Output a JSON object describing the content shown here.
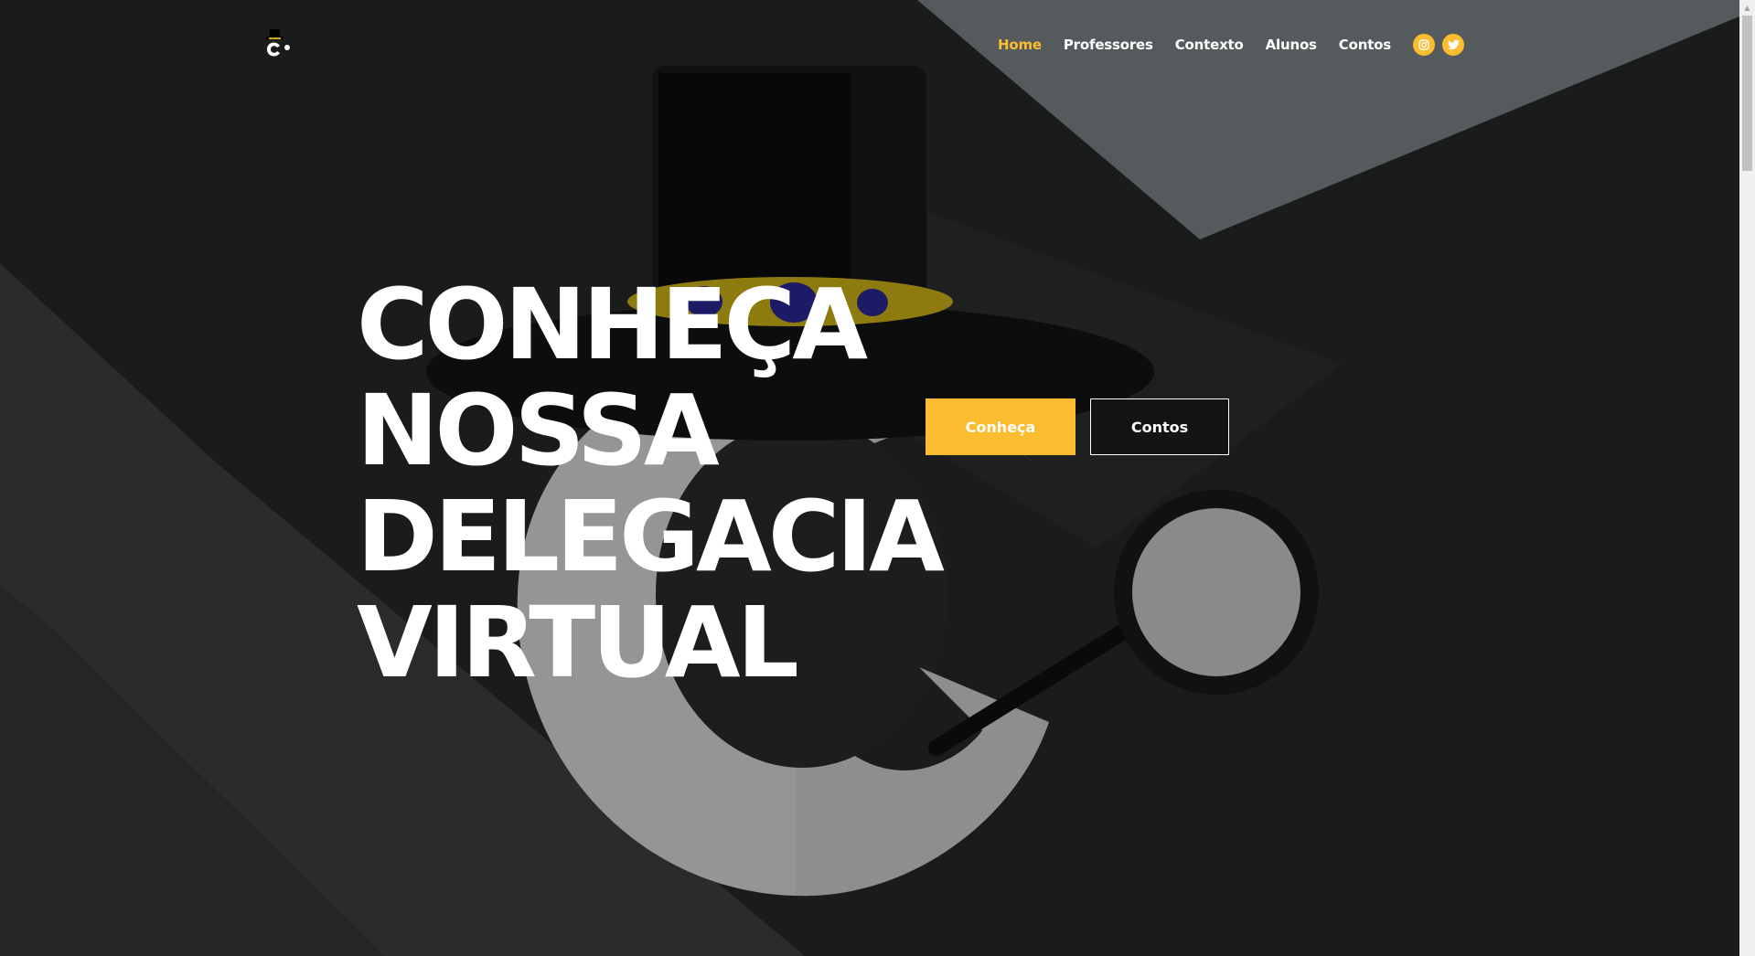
{
  "site": {
    "logo_icon": "detective-c-logo"
  },
  "nav": {
    "items": [
      {
        "label": "Home",
        "active": true
      },
      {
        "label": "Professores",
        "active": false
      },
      {
        "label": "Contexto",
        "active": false
      },
      {
        "label": "Alunos",
        "active": false
      },
      {
        "label": "Contos",
        "active": false
      }
    ],
    "social": [
      {
        "icon": "instagram-icon"
      },
      {
        "icon": "twitter-icon"
      }
    ]
  },
  "hero": {
    "title_lines": [
      "CONHEÇA",
      "NOSSA",
      "DELEGACIA",
      "VIRTUAL"
    ],
    "primary_button": "Conheça",
    "secondary_button": "Contos"
  },
  "colors": {
    "accent": "#fbbc2f",
    "background": "#1a1b1b",
    "text": "#ffffff"
  }
}
